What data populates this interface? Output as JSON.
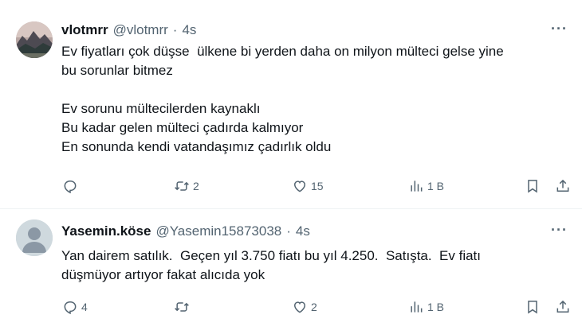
{
  "tweets": [
    {
      "name": "vlotmrr",
      "handle": "@vlotmrr",
      "separator": "·",
      "time": "4s",
      "lines": [
        "Ev fiyatları çok düşse  ülkene bi yerden daha on milyon mülteci gelse yine",
        "bu sorunlar bitmez",
        "",
        "Ev sorunu mültecilerden kaynaklı",
        "Bu kadar gelen mülteci çadırda kalmıyor",
        "En sonunda kendi vatandaşımız çadırlık oldu"
      ],
      "replies": "",
      "retweets": "2",
      "likes": "15",
      "views": "1 B"
    },
    {
      "name": "Yasemin.köse",
      "handle": "@Yasemin15873038",
      "separator": "·",
      "time": "4s",
      "lines": [
        "Yan dairem satılık.  Geçen yıl 3.750 fiatı bu yıl 4.250.  Satışta.  Ev fiatı",
        "düşmüyor artıyor fakat alıcıda yok"
      ],
      "replies": "4",
      "retweets": "",
      "likes": "2",
      "views": "1 B"
    }
  ],
  "more_label": "···",
  "colors": {
    "text": "#0f1419",
    "muted": "#536471",
    "divider": "#eff3f4",
    "avatar_placeholder": "#cfd9de"
  },
  "icons": [
    "reply-icon",
    "retweet-icon",
    "like-icon",
    "views-icon",
    "bookmark-icon",
    "share-icon",
    "more-icon"
  ]
}
